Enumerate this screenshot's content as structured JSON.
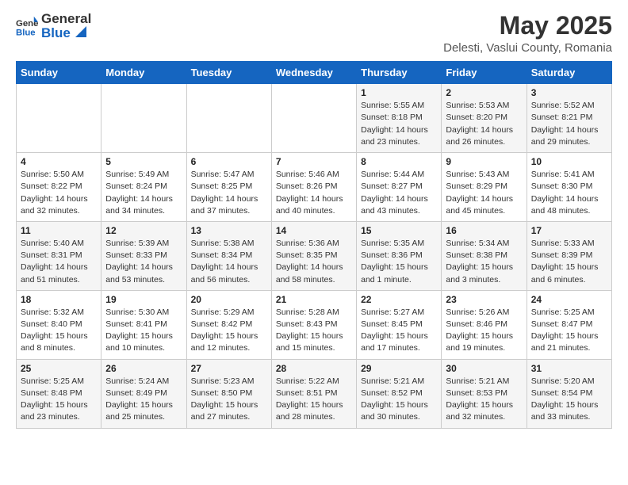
{
  "header": {
    "logo_general": "General",
    "logo_blue": "Blue",
    "title": "May 2025",
    "subtitle": "Delesti, Vaslui County, Romania"
  },
  "weekdays": [
    "Sunday",
    "Monday",
    "Tuesday",
    "Wednesday",
    "Thursday",
    "Friday",
    "Saturday"
  ],
  "weeks": [
    [
      {
        "day": "",
        "content": ""
      },
      {
        "day": "",
        "content": ""
      },
      {
        "day": "",
        "content": ""
      },
      {
        "day": "",
        "content": ""
      },
      {
        "day": "1",
        "content": "Sunrise: 5:55 AM\nSunset: 8:18 PM\nDaylight: 14 hours\nand 23 minutes."
      },
      {
        "day": "2",
        "content": "Sunrise: 5:53 AM\nSunset: 8:20 PM\nDaylight: 14 hours\nand 26 minutes."
      },
      {
        "day": "3",
        "content": "Sunrise: 5:52 AM\nSunset: 8:21 PM\nDaylight: 14 hours\nand 29 minutes."
      }
    ],
    [
      {
        "day": "4",
        "content": "Sunrise: 5:50 AM\nSunset: 8:22 PM\nDaylight: 14 hours\nand 32 minutes."
      },
      {
        "day": "5",
        "content": "Sunrise: 5:49 AM\nSunset: 8:24 PM\nDaylight: 14 hours\nand 34 minutes."
      },
      {
        "day": "6",
        "content": "Sunrise: 5:47 AM\nSunset: 8:25 PM\nDaylight: 14 hours\nand 37 minutes."
      },
      {
        "day": "7",
        "content": "Sunrise: 5:46 AM\nSunset: 8:26 PM\nDaylight: 14 hours\nand 40 minutes."
      },
      {
        "day": "8",
        "content": "Sunrise: 5:44 AM\nSunset: 8:27 PM\nDaylight: 14 hours\nand 43 minutes."
      },
      {
        "day": "9",
        "content": "Sunrise: 5:43 AM\nSunset: 8:29 PM\nDaylight: 14 hours\nand 45 minutes."
      },
      {
        "day": "10",
        "content": "Sunrise: 5:41 AM\nSunset: 8:30 PM\nDaylight: 14 hours\nand 48 minutes."
      }
    ],
    [
      {
        "day": "11",
        "content": "Sunrise: 5:40 AM\nSunset: 8:31 PM\nDaylight: 14 hours\nand 51 minutes."
      },
      {
        "day": "12",
        "content": "Sunrise: 5:39 AM\nSunset: 8:33 PM\nDaylight: 14 hours\nand 53 minutes."
      },
      {
        "day": "13",
        "content": "Sunrise: 5:38 AM\nSunset: 8:34 PM\nDaylight: 14 hours\nand 56 minutes."
      },
      {
        "day": "14",
        "content": "Sunrise: 5:36 AM\nSunset: 8:35 PM\nDaylight: 14 hours\nand 58 minutes."
      },
      {
        "day": "15",
        "content": "Sunrise: 5:35 AM\nSunset: 8:36 PM\nDaylight: 15 hours\nand 1 minute."
      },
      {
        "day": "16",
        "content": "Sunrise: 5:34 AM\nSunset: 8:38 PM\nDaylight: 15 hours\nand 3 minutes."
      },
      {
        "day": "17",
        "content": "Sunrise: 5:33 AM\nSunset: 8:39 PM\nDaylight: 15 hours\nand 6 minutes."
      }
    ],
    [
      {
        "day": "18",
        "content": "Sunrise: 5:32 AM\nSunset: 8:40 PM\nDaylight: 15 hours\nand 8 minutes."
      },
      {
        "day": "19",
        "content": "Sunrise: 5:30 AM\nSunset: 8:41 PM\nDaylight: 15 hours\nand 10 minutes."
      },
      {
        "day": "20",
        "content": "Sunrise: 5:29 AM\nSunset: 8:42 PM\nDaylight: 15 hours\nand 12 minutes."
      },
      {
        "day": "21",
        "content": "Sunrise: 5:28 AM\nSunset: 8:43 PM\nDaylight: 15 hours\nand 15 minutes."
      },
      {
        "day": "22",
        "content": "Sunrise: 5:27 AM\nSunset: 8:45 PM\nDaylight: 15 hours\nand 17 minutes."
      },
      {
        "day": "23",
        "content": "Sunrise: 5:26 AM\nSunset: 8:46 PM\nDaylight: 15 hours\nand 19 minutes."
      },
      {
        "day": "24",
        "content": "Sunrise: 5:25 AM\nSunset: 8:47 PM\nDaylight: 15 hours\nand 21 minutes."
      }
    ],
    [
      {
        "day": "25",
        "content": "Sunrise: 5:25 AM\nSunset: 8:48 PM\nDaylight: 15 hours\nand 23 minutes."
      },
      {
        "day": "26",
        "content": "Sunrise: 5:24 AM\nSunset: 8:49 PM\nDaylight: 15 hours\nand 25 minutes."
      },
      {
        "day": "27",
        "content": "Sunrise: 5:23 AM\nSunset: 8:50 PM\nDaylight: 15 hours\nand 27 minutes."
      },
      {
        "day": "28",
        "content": "Sunrise: 5:22 AM\nSunset: 8:51 PM\nDaylight: 15 hours\nand 28 minutes."
      },
      {
        "day": "29",
        "content": "Sunrise: 5:21 AM\nSunset: 8:52 PM\nDaylight: 15 hours\nand 30 minutes."
      },
      {
        "day": "30",
        "content": "Sunrise: 5:21 AM\nSunset: 8:53 PM\nDaylight: 15 hours\nand 32 minutes."
      },
      {
        "day": "31",
        "content": "Sunrise: 5:20 AM\nSunset: 8:54 PM\nDaylight: 15 hours\nand 33 minutes."
      }
    ]
  ]
}
